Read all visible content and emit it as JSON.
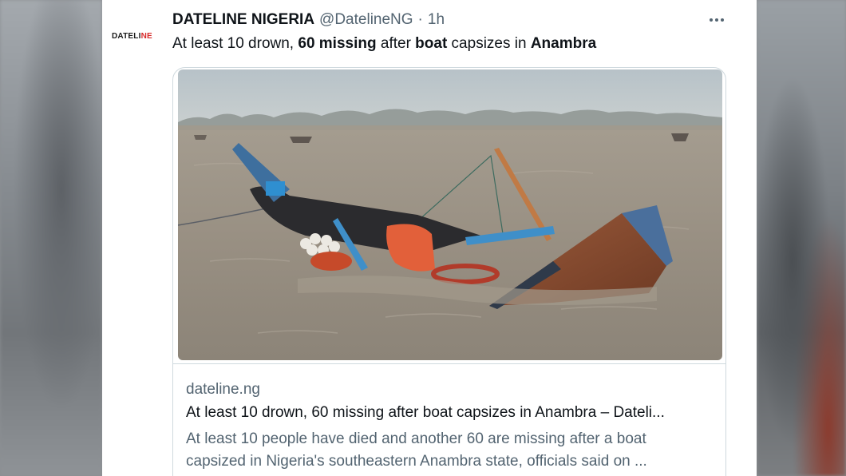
{
  "tweet": {
    "avatar_text_main": "DATELI",
    "avatar_text_accent": "NE",
    "display_name": "DATELINE NIGERIA",
    "handle": "@DatelineNG",
    "separator": "·",
    "timestamp": "1h",
    "text_parts": [
      {
        "text": "At least 10 drown, ",
        "bold": false
      },
      {
        "text": "60 missing",
        "bold": true
      },
      {
        "text": " after ",
        "bold": false
      },
      {
        "text": "boat",
        "bold": true
      },
      {
        "text": " capsizes in ",
        "bold": false
      },
      {
        "text": "Anambra",
        "bold": true
      }
    ],
    "more_icon": "more-horizontal-icon"
  },
  "link_card": {
    "image_subject": "capsized boat in river",
    "domain": "dateline.ng",
    "title": "At least 10 drown, 60 missing after boat capsizes in Anambra – Dateli...",
    "description_line1": "At least 10 people have died and another 60 are missing after a boat",
    "description_line2": "capsized in Nigeria's southeastern Anambra state, officials said on ..."
  },
  "colors": {
    "text_primary": "#0f1419",
    "text_secondary": "#536471",
    "border": "#cfd9de",
    "logo_accent": "#d62828"
  }
}
